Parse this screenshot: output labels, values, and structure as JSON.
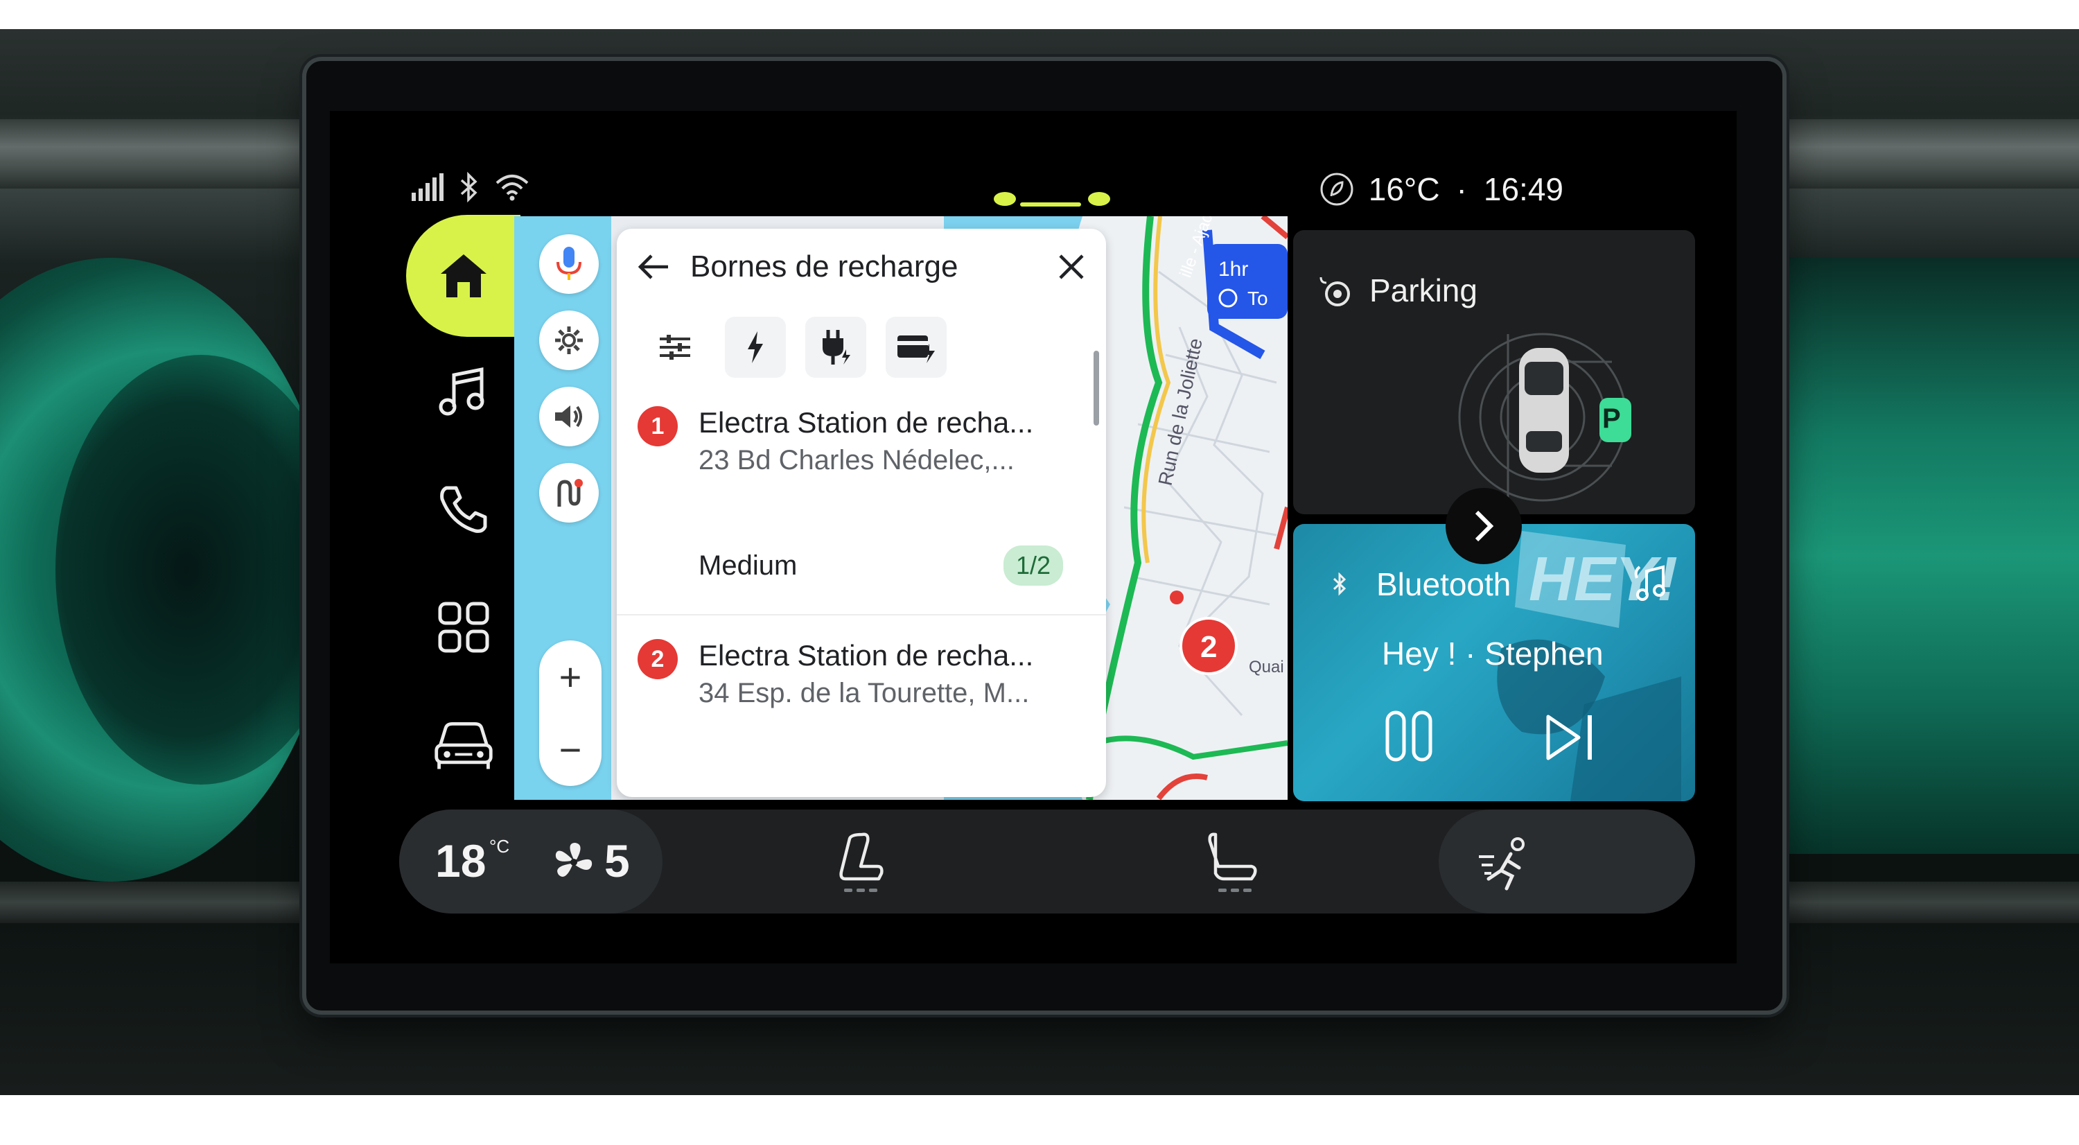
{
  "status": {
    "temperature": "16°C",
    "separator": "·",
    "time": "16:49"
  },
  "rail": {
    "items": [
      "home-icon",
      "music-icon",
      "phone-icon",
      "apps-grid-icon",
      "car-icon"
    ]
  },
  "search_panel": {
    "title": "Bornes de recharge",
    "results": [
      {
        "index": "1",
        "name": "Electra Station de recha...",
        "address": "23 Bd Charles Nédelec,...",
        "speed": "Medium",
        "availability": "1/2"
      },
      {
        "index": "2",
        "name": "Electra Station de recha...",
        "address": "34 Esp. de la Tourette, M..."
      }
    ]
  },
  "map": {
    "street_label": "Run de la Joliette",
    "street_label_2": "ille - Ajaccio",
    "quai_label": "Quai",
    "route_badge": "1hr",
    "route_badge_sub": "To",
    "marker_2": "2",
    "zoom_in": "+",
    "zoom_out": "−"
  },
  "parking": {
    "title": "Parking",
    "spot_label": "P"
  },
  "media": {
    "source": "Bluetooth",
    "track": "Hey ! · Stephen",
    "artwork_text": "HEY!"
  },
  "climate": {
    "temperature": "18",
    "temperature_unit": "°C",
    "fan_level": "5"
  },
  "colors": {
    "accent": "#d9f24a",
    "marker": "#e53935",
    "availability_bg": "#c9ecd2",
    "parking_p": "#3ddc97"
  }
}
